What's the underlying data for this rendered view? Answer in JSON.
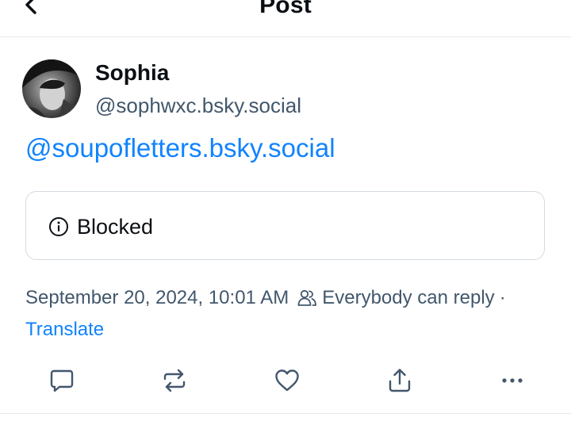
{
  "header": {
    "title": "Post",
    "back_icon": "chevron-left-icon"
  },
  "author": {
    "name": "Sophia",
    "handle": "@sophwxc.bsky.social",
    "avatar_icon": "avatar"
  },
  "post": {
    "text": "@soupofletters.bsky.social",
    "embed": {
      "icon": "info-circle-icon",
      "label": "Blocked"
    },
    "timestamp": "September 20, 2024, 10:01 AM",
    "reply_setting_icon": "people-icon",
    "reply_setting": "Everybody can reply",
    "separator": "·",
    "translate": "Translate"
  },
  "actions": [
    {
      "icon": "reply-icon"
    },
    {
      "icon": "repost-icon"
    },
    {
      "icon": "like-heart-icon"
    },
    {
      "icon": "share-icon"
    },
    {
      "icon": "more-icon"
    }
  ],
  "colors": {
    "accent": "#1083fe",
    "muted": "#42576c",
    "text": "#0b0f14",
    "border": "#d4dbe2"
  }
}
